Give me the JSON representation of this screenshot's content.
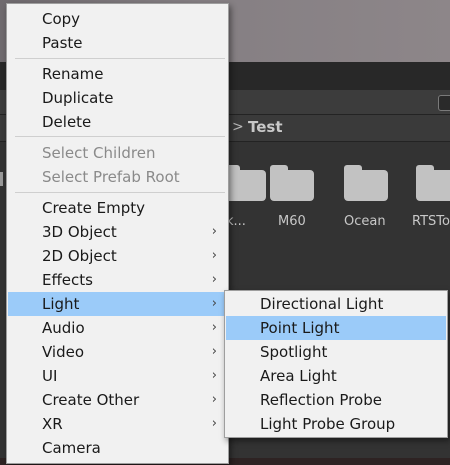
{
  "background": {
    "breadcrumb_separator": ">",
    "breadcrumb": "Test",
    "folders": [
      {
        "label": "k..."
      },
      {
        "label": "M60"
      },
      {
        "label": "Ocean"
      },
      {
        "label": "RTSTo"
      }
    ]
  },
  "context_menu": {
    "copy": "Copy",
    "paste": "Paste",
    "rename": "Rename",
    "duplicate": "Duplicate",
    "delete": "Delete",
    "select_children": "Select Children",
    "select_prefab_root": "Select Prefab Root",
    "create_empty": "Create Empty",
    "object_3d": "3D Object",
    "object_2d": "2D Object",
    "effects": "Effects",
    "light": "Light",
    "audio": "Audio",
    "video": "Video",
    "ui": "UI",
    "create_other": "Create Other",
    "xr": "XR",
    "camera": "Camera",
    "submenu_arrow": "›"
  },
  "light_submenu": {
    "directional_light": "Directional Light",
    "point_light": "Point Light",
    "spotlight": "Spotlight",
    "area_light": "Area Light",
    "reflection_probe": "Reflection Probe",
    "light_probe_group": "Light Probe Group"
  },
  "colors": {
    "menu_bg": "#f1f1f1",
    "highlight": "#9bcbf9",
    "disabled_text": "#8a8a8a"
  }
}
